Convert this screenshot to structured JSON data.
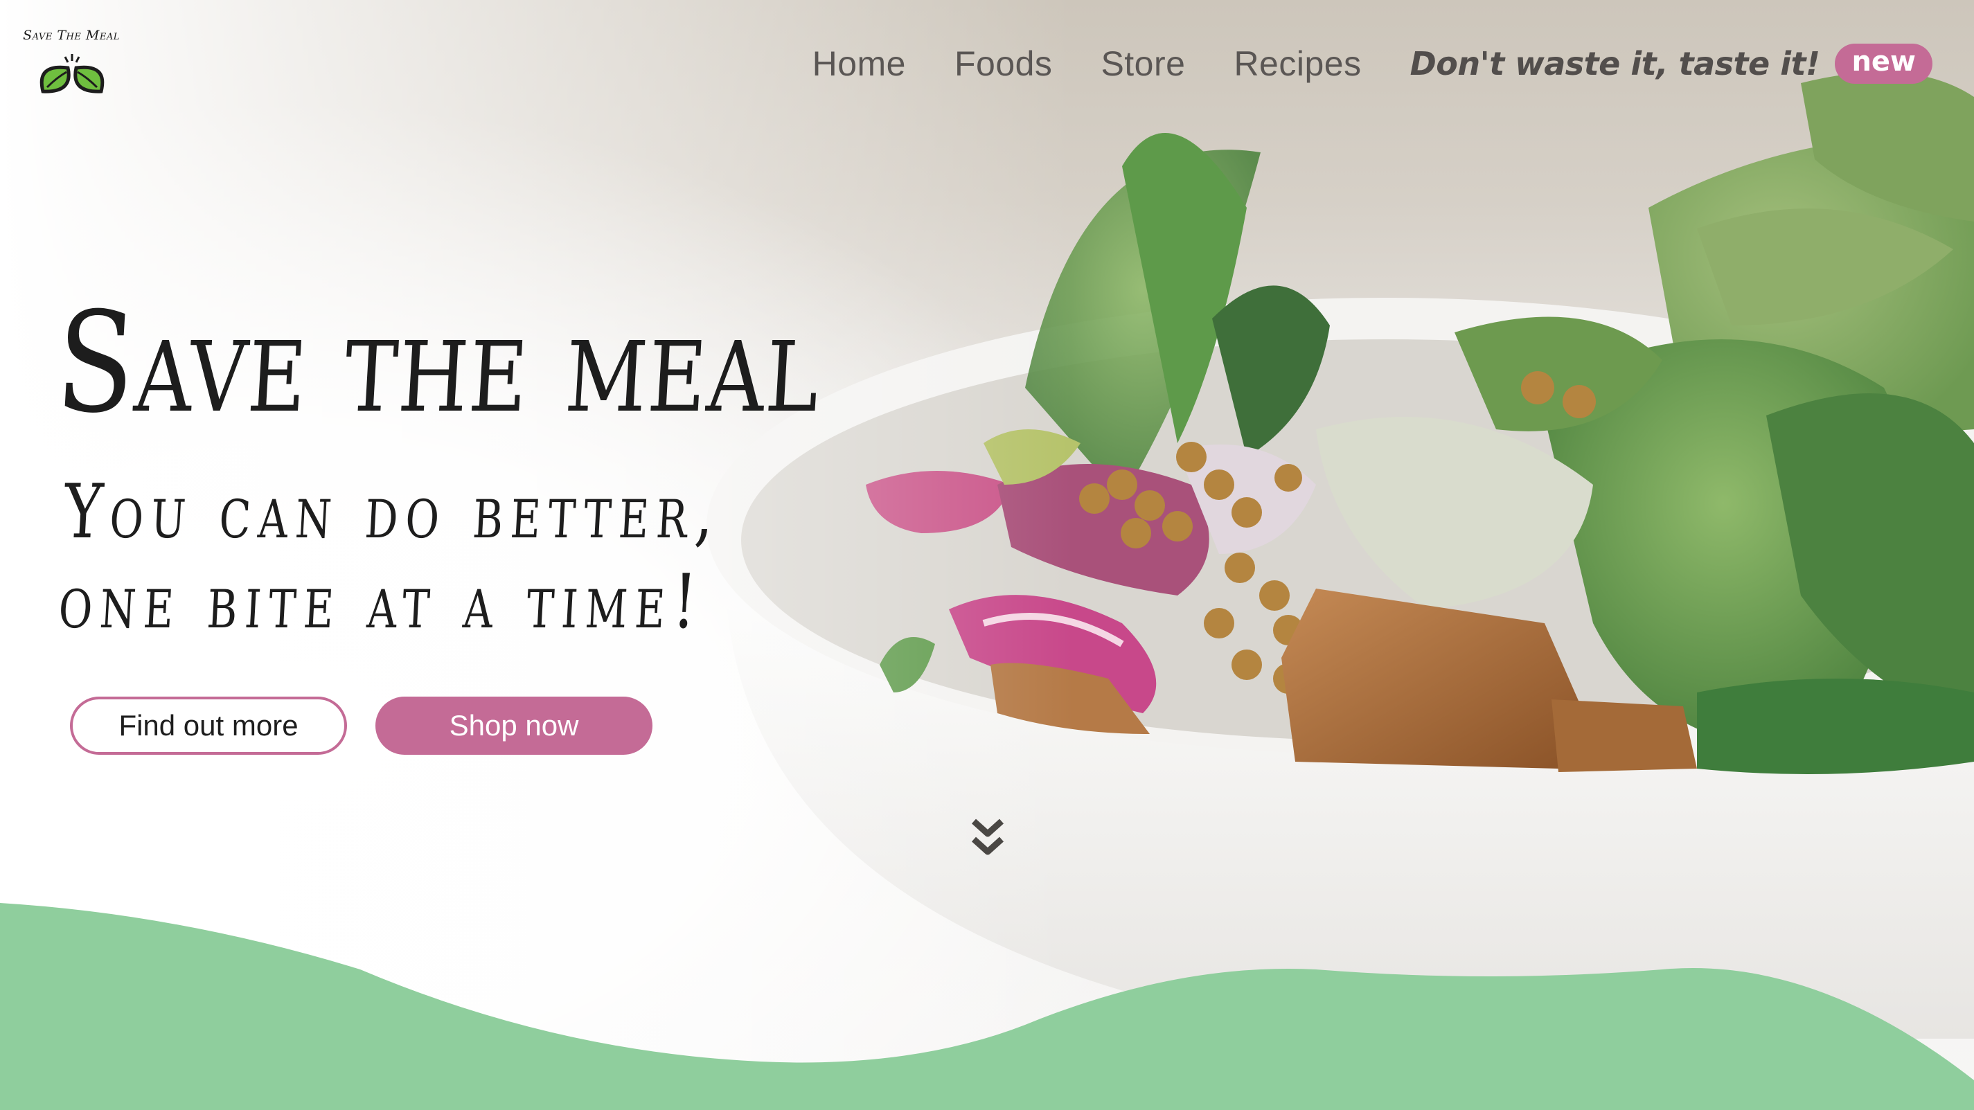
{
  "brand": {
    "name": "Save The Meal",
    "logo_icon": "leaves-icon"
  },
  "nav": {
    "items": [
      {
        "label": "Home"
      },
      {
        "label": "Foods"
      },
      {
        "label": "Store"
      },
      {
        "label": "Recipes"
      }
    ],
    "tagline": "Don't waste it, taste it!",
    "badge": "new"
  },
  "hero": {
    "title": "Save the meal",
    "subtitle_line1": "You can do better,",
    "subtitle_line2": "one bite at a time!",
    "image": "salad-bowl-photo"
  },
  "buttons": {
    "find_out_more": "Find out more",
    "shop_now": "Shop now"
  },
  "scroll_indicator": {
    "icon": "double-chevron-down-icon"
  },
  "colors": {
    "accent": "#c46b96",
    "wave_green": "#8fce9d",
    "text_dark": "#1d1d1d",
    "nav_text": "#5a5654"
  }
}
